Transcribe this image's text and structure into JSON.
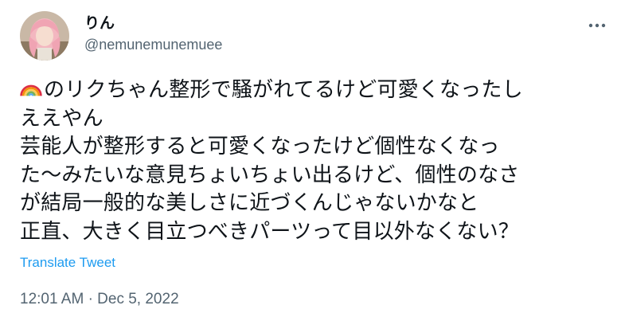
{
  "user": {
    "display_name": "りん",
    "handle": "@nemunemunemuee",
    "avatar_icon": "user-avatar-photo"
  },
  "menu": {
    "icon": "more-options-icon"
  },
  "tweet": {
    "emoji": "rainbow-emoji",
    "lines": [
      "のリクちゃん整形で騒がれてるけど可愛くなったし",
      "ええやん",
      "芸能人が整形すると可愛くなったけど個性なくなっ",
      "た〜みたいな意見ちょいちょい出るけど、個性のなさ",
      "が結局一般的な美しさに近づくんじゃないかなと",
      "正直、大きく目立つべきパーツって目以外なくない？"
    ]
  },
  "translate": {
    "label": "Translate Tweet"
  },
  "meta": {
    "time": "12:01 AM",
    "separator": "·",
    "date": "Dec 5, 2022"
  },
  "colors": {
    "link": "#1d9bf0",
    "muted": "#536471",
    "text": "#0f1419"
  }
}
